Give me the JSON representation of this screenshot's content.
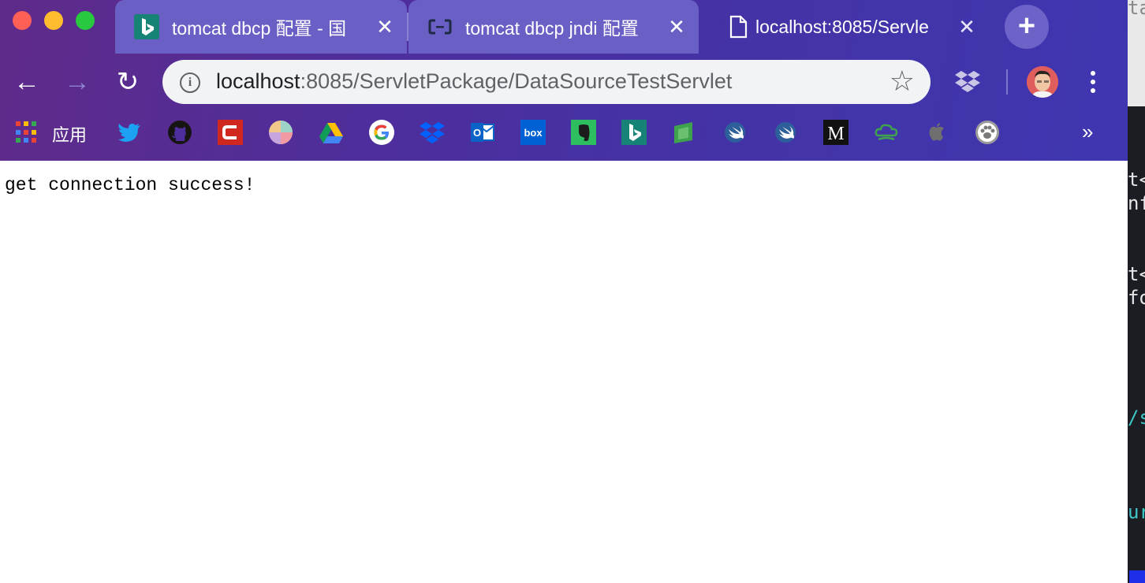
{
  "tabs": [
    {
      "title": "tomcat dbcp 配置 - 国",
      "icon": "bing-icon",
      "active": false
    },
    {
      "title": "tomcat dbcp jndi 配置",
      "icon": "alibaba-cloud-icon",
      "active": false
    },
    {
      "title": "localhost:8085/Servle",
      "icon": "document-icon",
      "active": true
    }
  ],
  "tab_close_glyph": "✕",
  "new_tab_glyph": "+",
  "toolbar": {
    "back_glyph": "←",
    "forward_glyph": "→",
    "reload_glyph": "↻",
    "info_glyph": "i",
    "star_glyph": "☆",
    "more_glyph": "»"
  },
  "address_bar": {
    "host": "localhost",
    "path": ":8085/ServletPackage/DataSourceTestServlet"
  },
  "bookmarks": {
    "apps_label": "应用",
    "icons": [
      "twitter-icon",
      "github-icon",
      "c-app-icon",
      "color-wheel-icon",
      "google-drive-icon",
      "google-icon",
      "dropbox-icon",
      "outlook-icon",
      "box-icon",
      "evernote-icon",
      "bing-icon",
      "green-app-icon",
      "swift-icon",
      "swift-icon-2",
      "medium-icon",
      "cloud-app-icon",
      "apple-icon",
      "paw-icon"
    ],
    "box_label": "box",
    "medium_label": "M",
    "outlook_label": "O"
  },
  "page": {
    "body_text": "get connection success!"
  },
  "right_editor_fragments": [
    "ta",
    "t<",
    "nf",
    "t<",
    "fo",
    "/s",
    "ur"
  ],
  "colors": {
    "chrome_gradient_start": "#5f2b8a",
    "chrome_gradient_end": "#3f36b0",
    "inactive_tab": "#6a5fc5",
    "omnibox": "#f1f3f4"
  }
}
